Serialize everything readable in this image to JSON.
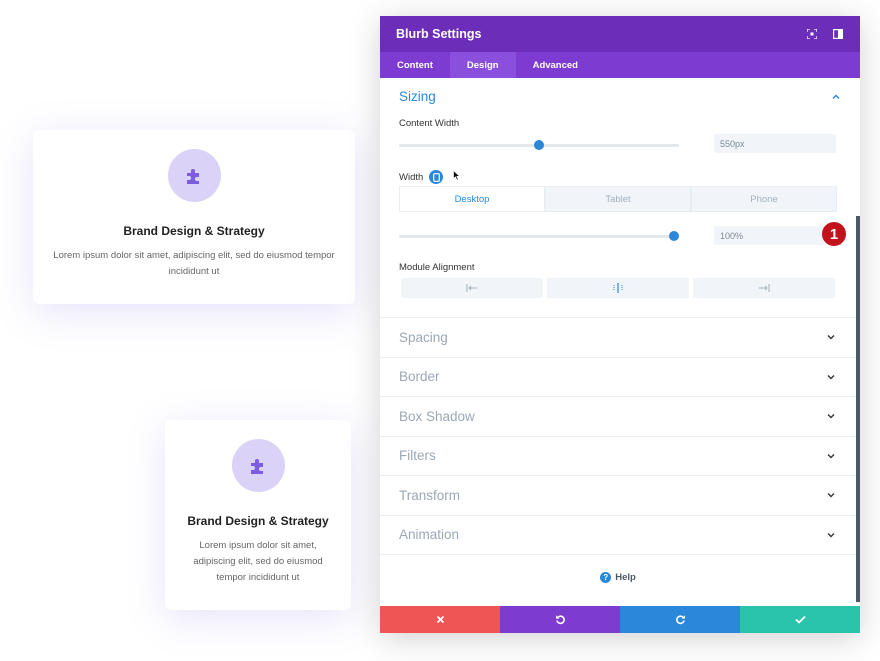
{
  "cards": [
    {
      "title": "Brand Design & Strategy",
      "description": "Lorem ipsum dolor sit amet, adipiscing elit, sed do eiusmod tempor incididunt ut"
    },
    {
      "title": "Brand Design & Strategy",
      "description": "Lorem ipsum dolor sit amet, adipiscing elit, sed do eiusmod tempor incididunt ut"
    }
  ],
  "modal": {
    "title": "Blurb Settings",
    "tabs": [
      {
        "label": "Content",
        "active": false
      },
      {
        "label": "Design",
        "active": true
      },
      {
        "label": "Advanced",
        "active": false
      }
    ],
    "sizing": {
      "title": "Sizing",
      "content_width": {
        "label": "Content Width",
        "value": "550px",
        "slider_fraction": 0.5
      },
      "width": {
        "label": "Width",
        "value": "100%",
        "slider_fraction": 1.0,
        "device_tabs": [
          {
            "label": "Desktop",
            "active": true
          },
          {
            "label": "Tablet",
            "active": false
          },
          {
            "label": "Phone",
            "active": false
          }
        ]
      },
      "module_alignment": {
        "label": "Module Alignment",
        "options": [
          "align-left",
          "align-center",
          "align-right"
        ]
      }
    },
    "callout_badge": "1",
    "sections": [
      "Spacing",
      "Border",
      "Box Shadow",
      "Filters",
      "Transform",
      "Animation"
    ],
    "help_label": "Help"
  },
  "colors": {
    "header": "#6c2eb9",
    "tabs": "#7d3bd1",
    "accent": "#2b87da",
    "cancel": "#ef5555",
    "undo": "#7e3bd0",
    "redo": "#2b87da",
    "save": "#29c4a9"
  }
}
